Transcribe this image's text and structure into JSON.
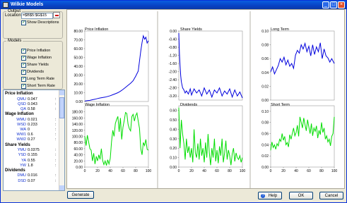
{
  "window": {
    "title": "Wilkie Models"
  },
  "output": {
    "legend": "Output",
    "location_label": "Location:",
    "location_value": "=$B$5:$G$15",
    "show_descriptions_label": "Show Descriptions",
    "show_descriptions_checked": true
  },
  "models": {
    "legend": "Models",
    "items": [
      {
        "label": "Price Inflation",
        "checked": true
      },
      {
        "label": "Wage Inflation",
        "checked": true
      },
      {
        "label": "Share Yields",
        "checked": true
      },
      {
        "label": "Dividends",
        "checked": true
      },
      {
        "label": "Long Term Rate",
        "checked": true
      },
      {
        "label": "Short Term Rate",
        "checked": true
      }
    ]
  },
  "parameters": {
    "groups": [
      {
        "title": "Price Inflation",
        "params": [
          {
            "key": "QMU",
            "value": "0.047"
          },
          {
            "key": "QSD",
            "value": "0.043"
          },
          {
            "key": "QA",
            "value": "0.58"
          }
        ]
      },
      {
        "title": "Wage Inflation",
        "params": [
          {
            "key": "WMU",
            "value": "0.021"
          },
          {
            "key": "WSD",
            "value": "0.233"
          },
          {
            "key": "WA",
            "value": "0"
          },
          {
            "key": "WW1",
            "value": "0.6"
          },
          {
            "key": "WW2",
            "value": "0.27"
          }
        ]
      },
      {
        "title": "Share Yields",
        "params": [
          {
            "key": "YMU",
            "value": "0.0375"
          },
          {
            "key": "YSD",
            "value": "0.155"
          },
          {
            "key": "YA",
            "value": "0.55"
          },
          {
            "key": "YW",
            "value": "1.8"
          }
        ]
      },
      {
        "title": "Dividends",
        "params": [
          {
            "key": "DMU",
            "value": "0.016"
          },
          {
            "key": "DSD",
            "value": "0.07"
          }
        ]
      }
    ]
  },
  "buttons": {
    "generate": "Generate",
    "help": "Help",
    "ok": "OK",
    "cancel": "Cancel"
  },
  "chart_data": [
    {
      "type": "line",
      "title": "Price Inflation",
      "color": "#0000dd",
      "x": [
        0,
        4,
        8,
        12,
        16,
        20,
        24,
        28,
        32,
        36,
        40,
        44,
        48,
        52,
        56,
        60,
        64,
        68,
        72,
        76,
        80,
        84,
        86,
        88,
        90,
        92,
        94,
        96,
        98,
        100
      ],
      "y": [
        0.5,
        1,
        1.3,
        2,
        2.6,
        3.4,
        4,
        4.5,
        5,
        5.8,
        6.6,
        7.7,
        8.8,
        10,
        11.7,
        13.7,
        16,
        18.4,
        20.7,
        23.6,
        28.7,
        34.5,
        46,
        57.4,
        67,
        74.6,
        70.7,
        73,
        66.3,
        69
      ],
      "ylim": [
        0,
        80
      ],
      "yticks": [
        "80.00",
        "70.00",
        "60.00",
        "50.00",
        "40.00",
        "30.00",
        "20.00",
        "10.00",
        "0.00"
      ]
    },
    {
      "type": "line",
      "title": "Share Yields",
      "color": "#0000dd",
      "x": [
        0,
        1,
        2,
        3,
        4,
        6,
        8,
        10,
        12,
        15,
        18,
        20,
        24,
        28,
        32,
        36,
        40,
        44,
        48,
        52,
        56,
        60,
        64,
        68,
        72,
        76,
        80,
        84,
        88,
        92,
        96,
        100
      ],
      "y": [
        -0.1,
        -1.1,
        -1.7,
        -2.2,
        -2.5,
        -2.8,
        -2.9,
        -3.05,
        -2.95,
        -3.1,
        -2.85,
        -3.15,
        -2.85,
        -3.05,
        -2.9,
        -3.2,
        -2.8,
        -3.1,
        -2.9,
        -3.25,
        -2.9,
        -3.05,
        -2.8,
        -3.2,
        -2.95,
        -3.1,
        -2.85,
        -3.25,
        -2.9,
        -3.2,
        -3.0,
        -3.3
      ],
      "ylim": [
        -3.4,
        0
      ],
      "yticks": [
        "0.00",
        "-0.40",
        "-0.80",
        "-1.20",
        "-1.60",
        "-2.00",
        "-2.40",
        "-2.80",
        "-3.20"
      ]
    },
    {
      "type": "line",
      "title": "Long Term",
      "color": "#0000dd",
      "x": [
        0,
        3,
        6,
        9,
        12,
        15,
        18,
        21,
        24,
        27,
        30,
        33,
        36,
        39,
        42,
        45,
        48,
        51,
        54,
        57,
        60,
        63,
        66,
        69,
        72,
        75,
        78,
        81,
        84,
        87,
        90,
        93,
        96,
        100
      ],
      "y": [
        0.041,
        0.048,
        0.038,
        0.044,
        0.05,
        0.06,
        0.055,
        0.062,
        0.051,
        0.058,
        0.049,
        0.053,
        0.046,
        0.065,
        0.072,
        0.068,
        0.08,
        0.074,
        0.082,
        0.07,
        0.078,
        0.064,
        0.08,
        0.066,
        0.077,
        0.07,
        0.083,
        0.06,
        0.074,
        0.064,
        0.061,
        0.055,
        0.06,
        0.053
      ],
      "ylim": [
        0,
        0.1
      ],
      "yticks": [
        "0.10",
        "0.08",
        "0.06",
        "0.04",
        "0.02",
        "0.00"
      ]
    },
    {
      "type": "line",
      "title": "Wage Inflation",
      "color": "#00dd00",
      "x": [
        0,
        2,
        4,
        6,
        8,
        10,
        12,
        14,
        16,
        18,
        20,
        22,
        24,
        26,
        28,
        30,
        32,
        34,
        36,
        38,
        40,
        42,
        44,
        46,
        48,
        50,
        52,
        54,
        56,
        58,
        60,
        62,
        64,
        66,
        68,
        70,
        72,
        74,
        76,
        78,
        80,
        82,
        84,
        86,
        88,
        90,
        92,
        94,
        96,
        98,
        100
      ],
      "y": [
        100,
        70,
        104,
        82,
        60,
        55,
        20,
        45,
        10,
        35,
        20,
        40,
        25,
        60,
        22,
        8,
        20,
        5,
        24,
        10,
        28,
        82,
        120,
        100,
        142,
        155,
        165,
        115,
        160,
        90,
        130,
        152,
        178,
        175,
        140,
        125,
        118,
        165,
        172,
        150,
        168,
        176,
        150,
        126,
        60,
        40,
        80,
        70,
        90,
        58,
        55
      ],
      "ylim": [
        0,
        200
      ],
      "yticks": [
        "180.00",
        "160.00",
        "140.00",
        "120.00",
        "100.00",
        "80.00",
        "60.00",
        "40.00",
        "20.00",
        "0.00"
      ],
      "xticks": [
        "0",
        "20",
        "40",
        "60",
        "80",
        "100"
      ]
    },
    {
      "type": "line",
      "title": "Dividends",
      "color": "#00dd00",
      "x": [
        0,
        2,
        4,
        6,
        8,
        10,
        12,
        14,
        16,
        18,
        20,
        22,
        24,
        26,
        28,
        30,
        32,
        34,
        36,
        38,
        40,
        42,
        44,
        46,
        48,
        50,
        52,
        54,
        56,
        58,
        60,
        62,
        64,
        66,
        68,
        70,
        72,
        74,
        76,
        78,
        80,
        82,
        84,
        86,
        88,
        90,
        92,
        94,
        96,
        98,
        100
      ],
      "y": [
        0.63,
        0.2,
        0.5,
        0.35,
        0.25,
        0.08,
        0.3,
        0.15,
        0.22,
        0.1,
        0.2,
        0.05,
        0.4,
        0.15,
        0.1,
        0.25,
        0.08,
        0.3,
        0.12,
        0.2,
        0.05,
        0.26,
        0.1,
        0.35,
        0.15,
        0.02,
        0.2,
        0.1,
        0.3,
        0.06,
        0.18,
        0.04,
        0.22,
        0.12,
        0.3,
        0.05,
        0.15,
        0.28,
        0.08,
        0.18,
        0.12,
        0.02,
        0.14,
        0.2,
        0.06,
        0.15,
        0.1,
        0.08,
        0.12,
        0.05,
        0.1
      ],
      "ylim": [
        0,
        0.65
      ],
      "yticks": [
        "0.60",
        "0.50",
        "0.40",
        "0.30",
        "0.20",
        "0.10",
        "0.00"
      ],
      "xticks": [
        "0",
        "20",
        "40",
        "60",
        "80",
        "100"
      ]
    },
    {
      "type": "line",
      "title": "Short Term",
      "color": "#00dd00",
      "x": [
        0,
        2,
        4,
        6,
        8,
        10,
        12,
        14,
        16,
        18,
        20,
        22,
        24,
        26,
        28,
        30,
        32,
        34,
        36,
        38,
        40,
        42,
        44,
        46,
        48,
        50,
        52,
        54,
        56,
        58,
        60,
        62,
        64,
        66,
        68,
        70,
        72,
        74,
        76,
        78,
        80,
        82,
        84,
        86,
        88,
        90,
        92,
        94,
        96,
        98,
        100
      ],
      "y": [
        0.03,
        0.045,
        0.035,
        0.04,
        0.032,
        0.042,
        0.038,
        0.05,
        0.046,
        0.06,
        0.048,
        0.055,
        0.04,
        0.044,
        0.036,
        0.058,
        0.05,
        0.06,
        0.07,
        0.056,
        0.062,
        0.075,
        0.055,
        0.09,
        0.08,
        0.07,
        0.088,
        0.076,
        0.065,
        0.085,
        0.072,
        0.06,
        0.078,
        0.056,
        0.07,
        0.064,
        0.074,
        0.052,
        0.066,
        0.058,
        0.08,
        0.062,
        0.07,
        0.05,
        0.056,
        0.045,
        0.05,
        0.038,
        0.055,
        0.06,
        0.09
      ],
      "ylim": [
        0,
        0.11
      ],
      "yticks": [
        "0.10",
        "0.08",
        "0.06",
        "0.04",
        "0.02",
        "0.00"
      ],
      "xticks": [
        "0",
        "20",
        "40",
        "60",
        "80",
        "100"
      ]
    }
  ]
}
